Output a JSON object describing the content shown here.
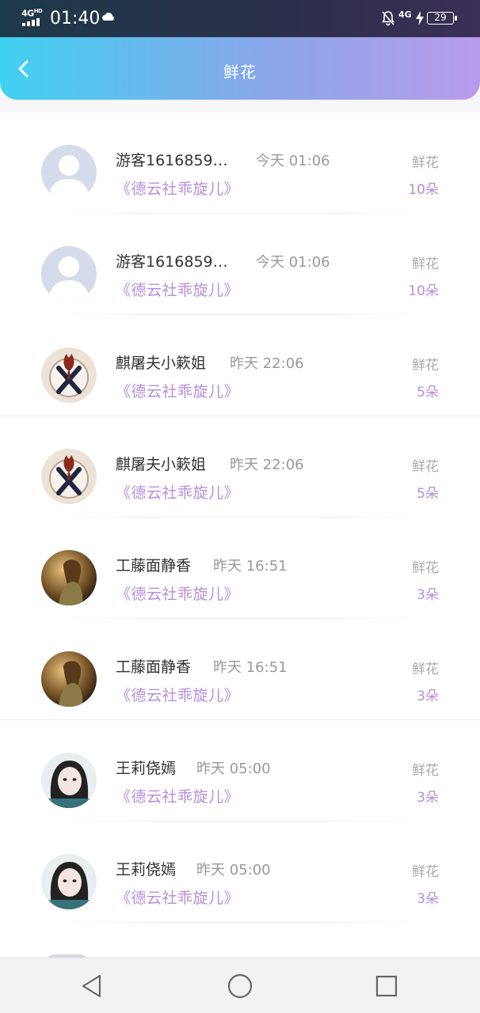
{
  "status_bar": {
    "network": "4G",
    "network_sup": "HD",
    "time": "01:40",
    "cellular": "4G",
    "battery": "29"
  },
  "header": {
    "title": "鲜花"
  },
  "list": [
    {
      "name": "游客1616859…",
      "time": "今天 01:06",
      "program": "《德云社乖旋儿》",
      "gift_type": "鲜花",
      "gift_count": "10朵",
      "avatar": "default-avatar"
    },
    {
      "name": "游客1616859…",
      "time": "今天 01:06",
      "program": "《德云社乖旋儿》",
      "gift_type": "鲜花",
      "gift_count": "10朵",
      "avatar": "default-avatar"
    },
    {
      "name": "麒屠夫小簌姐",
      "time": "昨天 22:06",
      "program": "《德云社乖旋儿》",
      "gift_type": "鲜花",
      "gift_count": "5朵",
      "avatar": "emblem-avatar"
    },
    {
      "name": "麒屠夫小簌姐",
      "time": "昨天 22:06",
      "program": "《德云社乖旋儿》",
      "gift_type": "鲜花",
      "gift_count": "5朵",
      "avatar": "emblem-avatar"
    },
    {
      "name": "工藤面静香",
      "time": "昨天 16:51",
      "program": "《德云社乖旋儿》",
      "gift_type": "鲜花",
      "gift_count": "3朵",
      "avatar": "photo-avatar"
    },
    {
      "name": "工藤面静香",
      "time": "昨天 16:51",
      "program": "《德云社乖旋儿》",
      "gift_type": "鲜花",
      "gift_count": "3朵",
      "avatar": "photo-avatar"
    },
    {
      "name": "王莉侥嫣",
      "time": "昨天 05:00",
      "program": "《德云社乖旋儿》",
      "gift_type": "鲜花",
      "gift_count": "3朵",
      "avatar": "girl-avatar"
    },
    {
      "name": "王莉侥嫣",
      "time": "昨天 05:00",
      "program": "《德云社乖旋儿》",
      "gift_type": "鲜花",
      "gift_count": "3朵",
      "avatar": "girl-avatar"
    }
  ],
  "nav": {
    "back": "triangle-back-icon",
    "home": "circle-home-icon",
    "recents": "square-recents-icon"
  },
  "colors": {
    "header_start": "#3fd1f1",
    "header_end": "#b89bea",
    "accent": "#b48fdc"
  }
}
